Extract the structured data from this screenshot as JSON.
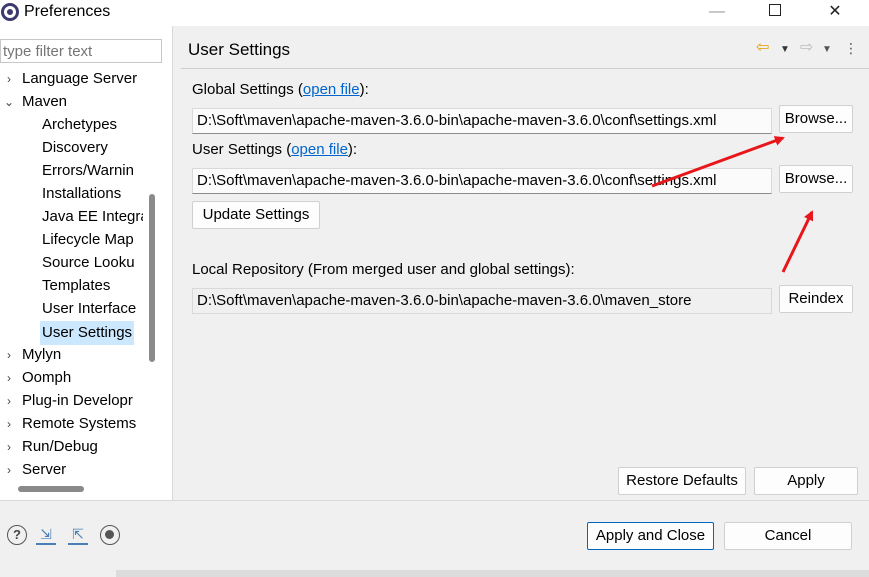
{
  "window": {
    "title": "Preferences",
    "minimize_glyph": "—",
    "close_glyph": "✕"
  },
  "sidebar": {
    "filter_placeholder": "type filter text",
    "items": [
      {
        "label": "Language Server",
        "arrow": "›",
        "level": 0
      },
      {
        "label": "Maven",
        "arrow": "⌄",
        "level": 0
      },
      {
        "label": "Archetypes",
        "level": 1
      },
      {
        "label": "Discovery",
        "level": 1
      },
      {
        "label": "Errors/Warnin",
        "level": 1
      },
      {
        "label": "Installations",
        "level": 1
      },
      {
        "label": "Java EE Integra",
        "level": 1
      },
      {
        "label": "Lifecycle Map",
        "level": 1
      },
      {
        "label": "Source Looku",
        "level": 1
      },
      {
        "label": "Templates",
        "level": 1
      },
      {
        "label": "User Interface",
        "level": 1
      },
      {
        "label": "User Settings",
        "level": 1,
        "selected": true
      },
      {
        "label": "Mylyn",
        "arrow": "›",
        "level": 0
      },
      {
        "label": "Oomph",
        "arrow": "›",
        "level": 0
      },
      {
        "label": "Plug-in Developr",
        "arrow": "›",
        "level": 0
      },
      {
        "label": "Remote Systems",
        "arrow": "›",
        "level": 0
      },
      {
        "label": "Run/Debug",
        "arrow": "›",
        "level": 0
      },
      {
        "label": "Server",
        "arrow": "›",
        "level": 0
      }
    ]
  },
  "page": {
    "title": "User Settings",
    "nav": {
      "back_icon": "⇦",
      "forward_icon": "⇨",
      "dropdown_glyph": "▼",
      "menu_glyph": "⋮"
    },
    "global": {
      "label_prefix": "Global Settings (",
      "link": "open file",
      "label_suffix": "):",
      "path": "D:\\Soft\\maven\\apache-maven-3.6.0-bin\\apache-maven-3.6.0\\conf\\settings.xml",
      "browse": "Browse..."
    },
    "user": {
      "label_prefix": "User Settings (",
      "link": "open file",
      "label_suffix": "):",
      "path": "D:\\Soft\\maven\\apache-maven-3.6.0-bin\\apache-maven-3.6.0\\conf\\settings.xml",
      "browse": "Browse..."
    },
    "update_button": "Update Settings",
    "local_repo": {
      "label": "Local Repository (From merged user and global settings):",
      "path": "D:\\Soft\\maven\\apache-maven-3.6.0-bin\\apache-maven-3.6.0\\maven_store",
      "reindex": "Reindex"
    },
    "restore_defaults": "Restore Defaults",
    "apply": "Apply"
  },
  "footer": {
    "help_glyph": "?",
    "import_glyph": "⇲",
    "export_glyph": "⇱",
    "apply_and_close": "Apply and Close",
    "cancel": "Cancel"
  },
  "colors": {
    "selection": "#cce8ff",
    "link": "#0066cc",
    "annotation_arrow": "#e8161b",
    "default_button_border": "#0067c0"
  }
}
